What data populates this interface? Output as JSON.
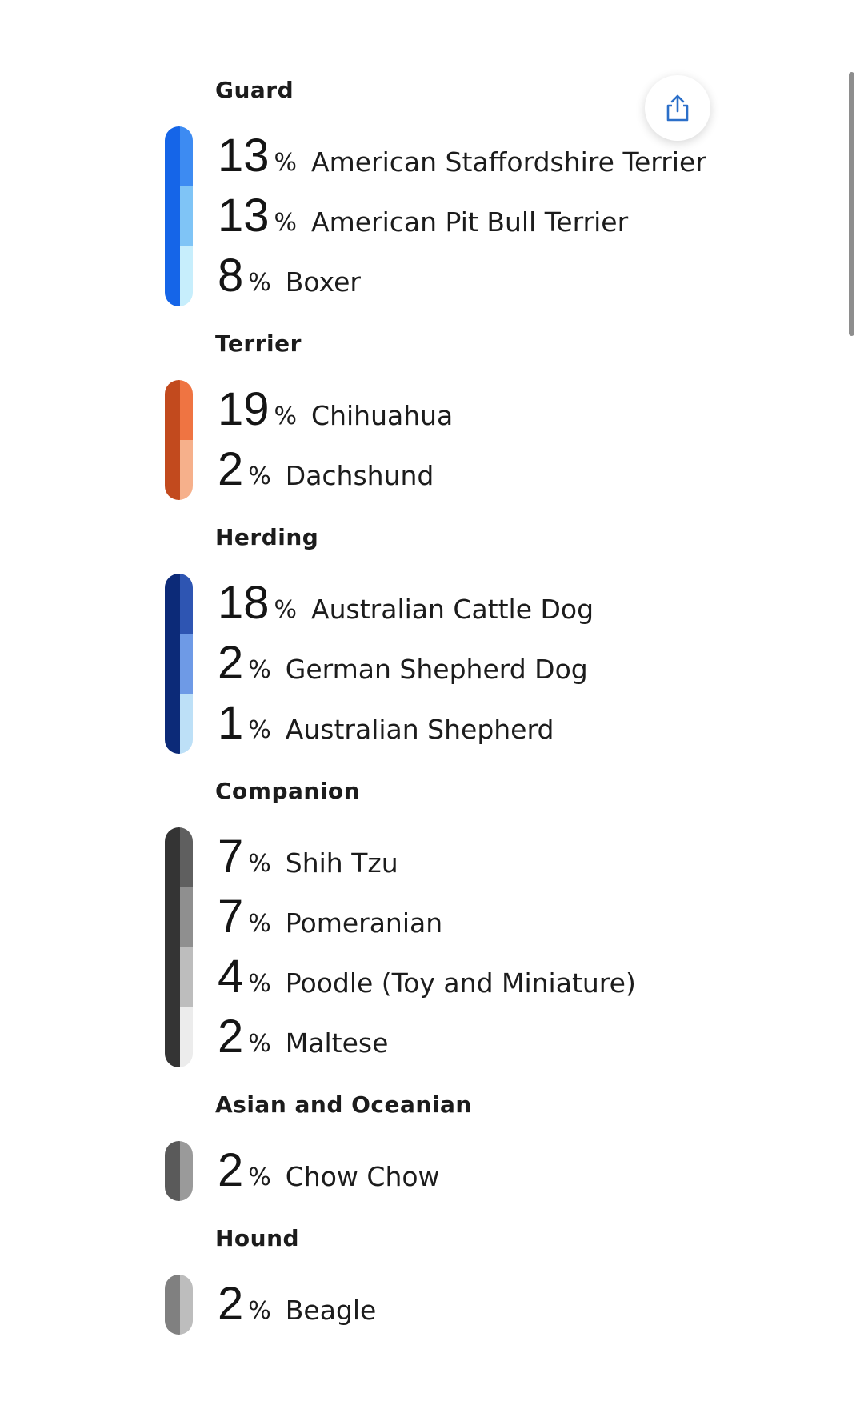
{
  "share": {
    "icon": "share-icon"
  },
  "groups": [
    {
      "title": "Guard",
      "color_dark": "#1565e8",
      "breeds": [
        {
          "pct": "13",
          "name": "American Staffordshire Terrier",
          "color": "#3d8bf2"
        },
        {
          "pct": "13",
          "name": "American Pit Bull Terrier",
          "color": "#7fc4f6"
        },
        {
          "pct": "8",
          "name": "Boxer",
          "color": "#c7eefc"
        }
      ]
    },
    {
      "title": "Terrier",
      "color_dark": "#c24a1e",
      "breeds": [
        {
          "pct": "19",
          "name": "Chihuahua",
          "color": "#ef7442"
        },
        {
          "pct": "2",
          "name": "Dachshund",
          "color": "#f6b08b"
        }
      ]
    },
    {
      "title": "Herding",
      "color_dark": "#0c2a78",
      "breeds": [
        {
          "pct": "18",
          "name": "Australian Cattle Dog",
          "color": "#2e55b2"
        },
        {
          "pct": "2",
          "name": "German Shepherd Dog",
          "color": "#6e9ae6"
        },
        {
          "pct": "1",
          "name": "Australian Shepherd",
          "color": "#bde0f7"
        }
      ]
    },
    {
      "title": "Companion",
      "color_dark": "#343434",
      "breeds": [
        {
          "pct": "7",
          "name": "Shih Tzu",
          "color": "#5f5f5f"
        },
        {
          "pct": "7",
          "name": "Pomeranian",
          "color": "#8f8f8f"
        },
        {
          "pct": "4",
          "name": "Poodle (Toy and Miniature)",
          "color": "#bdbdbd"
        },
        {
          "pct": "2",
          "name": "Maltese",
          "color": "#ececec"
        }
      ]
    },
    {
      "title": "Asian and Oceanian",
      "color_dark": "#5a5a5a",
      "breeds": [
        {
          "pct": "2",
          "name": "Chow Chow",
          "color": "#9a9a9a"
        }
      ]
    },
    {
      "title": "Hound",
      "color_dark": "#808080",
      "breeds": [
        {
          "pct": "2",
          "name": "Beagle",
          "color": "#bdbdbd"
        }
      ]
    }
  ],
  "pct_sign": "%"
}
